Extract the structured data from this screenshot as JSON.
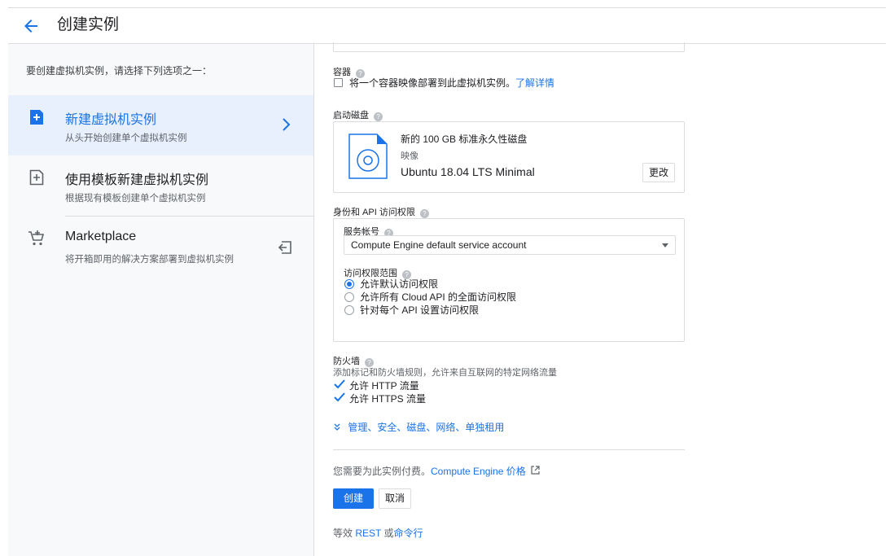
{
  "header": {
    "title": "创建实例"
  },
  "sidebar": {
    "intro": "要创建虚拟机实例，请选择下列选项之一：",
    "options": [
      {
        "title": "新建虚拟机实例",
        "subtitle": "从头开始创建单个虚拟机实例",
        "icon": "add-box-icon"
      },
      {
        "title": "使用模板新建虚拟机实例",
        "subtitle": "根据现有模板创建单个虚拟机实例",
        "icon": "template-add-icon"
      },
      {
        "title": "Marketplace",
        "subtitle": "将开箱即用的解决方案部署到虚拟机实例",
        "icon": "cart-icon"
      }
    ]
  },
  "container": {
    "label": "容器",
    "checkbox_text": "将一个容器映像部署到此虚拟机实例。",
    "link": "了解详情"
  },
  "boot_disk": {
    "label": "启动磁盘",
    "description": "新的 100 GB 标准永久性磁盘",
    "image_label": "映像",
    "image_name": "Ubuntu 18.04 LTS Minimal",
    "change_button": "更改"
  },
  "identity": {
    "label": "身份和 API 访问权限",
    "service_account_label": "服务帐号",
    "service_account_value": "Compute Engine default service account",
    "scope_label": "访问权限范围",
    "scopes": [
      "允许默认访问权限",
      "允许所有 Cloud API 的全面访问权限",
      "针对每个 API 设置访问权限"
    ],
    "selected_scope": 0
  },
  "firewall": {
    "label": "防火墙",
    "description": "添加标记和防火墙规则，允许来自互联网的特定网络流量",
    "http": "允许 HTTP 流量",
    "https": "允许 HTTPS 流量"
  },
  "advanced": {
    "link": "管理、安全、磁盘、网络、单独租用"
  },
  "billing": {
    "text": "您需要为此实例付费。",
    "link": "Compute Engine 价格"
  },
  "actions": {
    "create": "创建",
    "cancel": "取消"
  },
  "equivalent": {
    "prefix": "等效",
    "rest": "REST",
    "or": "或",
    "cli": "命令行"
  },
  "colors": {
    "accent": "#1a73e8",
    "selected_bg": "#e8f0fe",
    "sidebar_bg": "#f8f9fa"
  }
}
